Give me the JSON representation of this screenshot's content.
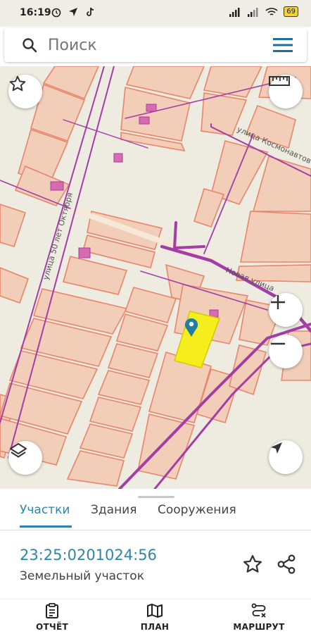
{
  "status_bar": {
    "time": "16:19",
    "battery": "69"
  },
  "search": {
    "placeholder": "Поиск"
  },
  "map": {
    "street_labels": [
      "улица 50 лет Октября",
      "улица Космонавтов",
      "Новая улица"
    ],
    "controls": [
      "star-icon",
      "ruler-icon",
      "plus-icon",
      "minus-icon",
      "layers-icon",
      "navigation-arrow-icon"
    ]
  },
  "sheet": {
    "tabs": [
      "Участки",
      "Здания",
      "Сооружения"
    ],
    "active_tab": "Участки",
    "cadastral_number": "23:25:0201024:56",
    "object_type": "Земельный участок"
  },
  "bottom_nav": {
    "items": [
      {
        "label": "ОТЧЁТ",
        "icon": "clipboard-icon"
      },
      {
        "label": "ПЛАН",
        "icon": "map-icon"
      },
      {
        "label": "МАРШРУТ",
        "icon": "route-icon"
      }
    ]
  },
  "colors": {
    "accent": "#2f86a8",
    "map_background": "#eeece0",
    "parcel_fill": "#f2cdb8",
    "parcel_stroke": "#e8856a",
    "road_line": "#a23ea6",
    "selected_parcel": "#f5ee1c",
    "marker": "#1e7fa0"
  }
}
